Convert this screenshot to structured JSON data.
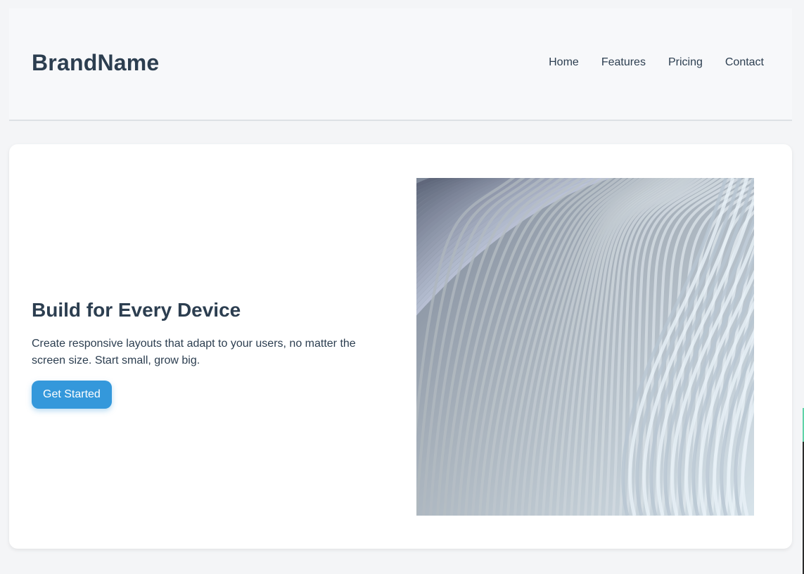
{
  "header": {
    "brand": "BrandName",
    "nav": [
      {
        "label": "Home"
      },
      {
        "label": "Features"
      },
      {
        "label": "Pricing"
      },
      {
        "label": "Contact"
      }
    ]
  },
  "hero": {
    "title": "Build for Every Device",
    "description": "Create responsive layouts that adapt to your users, no matter the screen size. Start small, grow big.",
    "cta_label": "Get Started",
    "image_icon": "abstract-wave-image"
  },
  "colors": {
    "text": "#2c3e50",
    "accent": "#3498db",
    "background": "#f4f5f7",
    "card": "#ffffff"
  }
}
